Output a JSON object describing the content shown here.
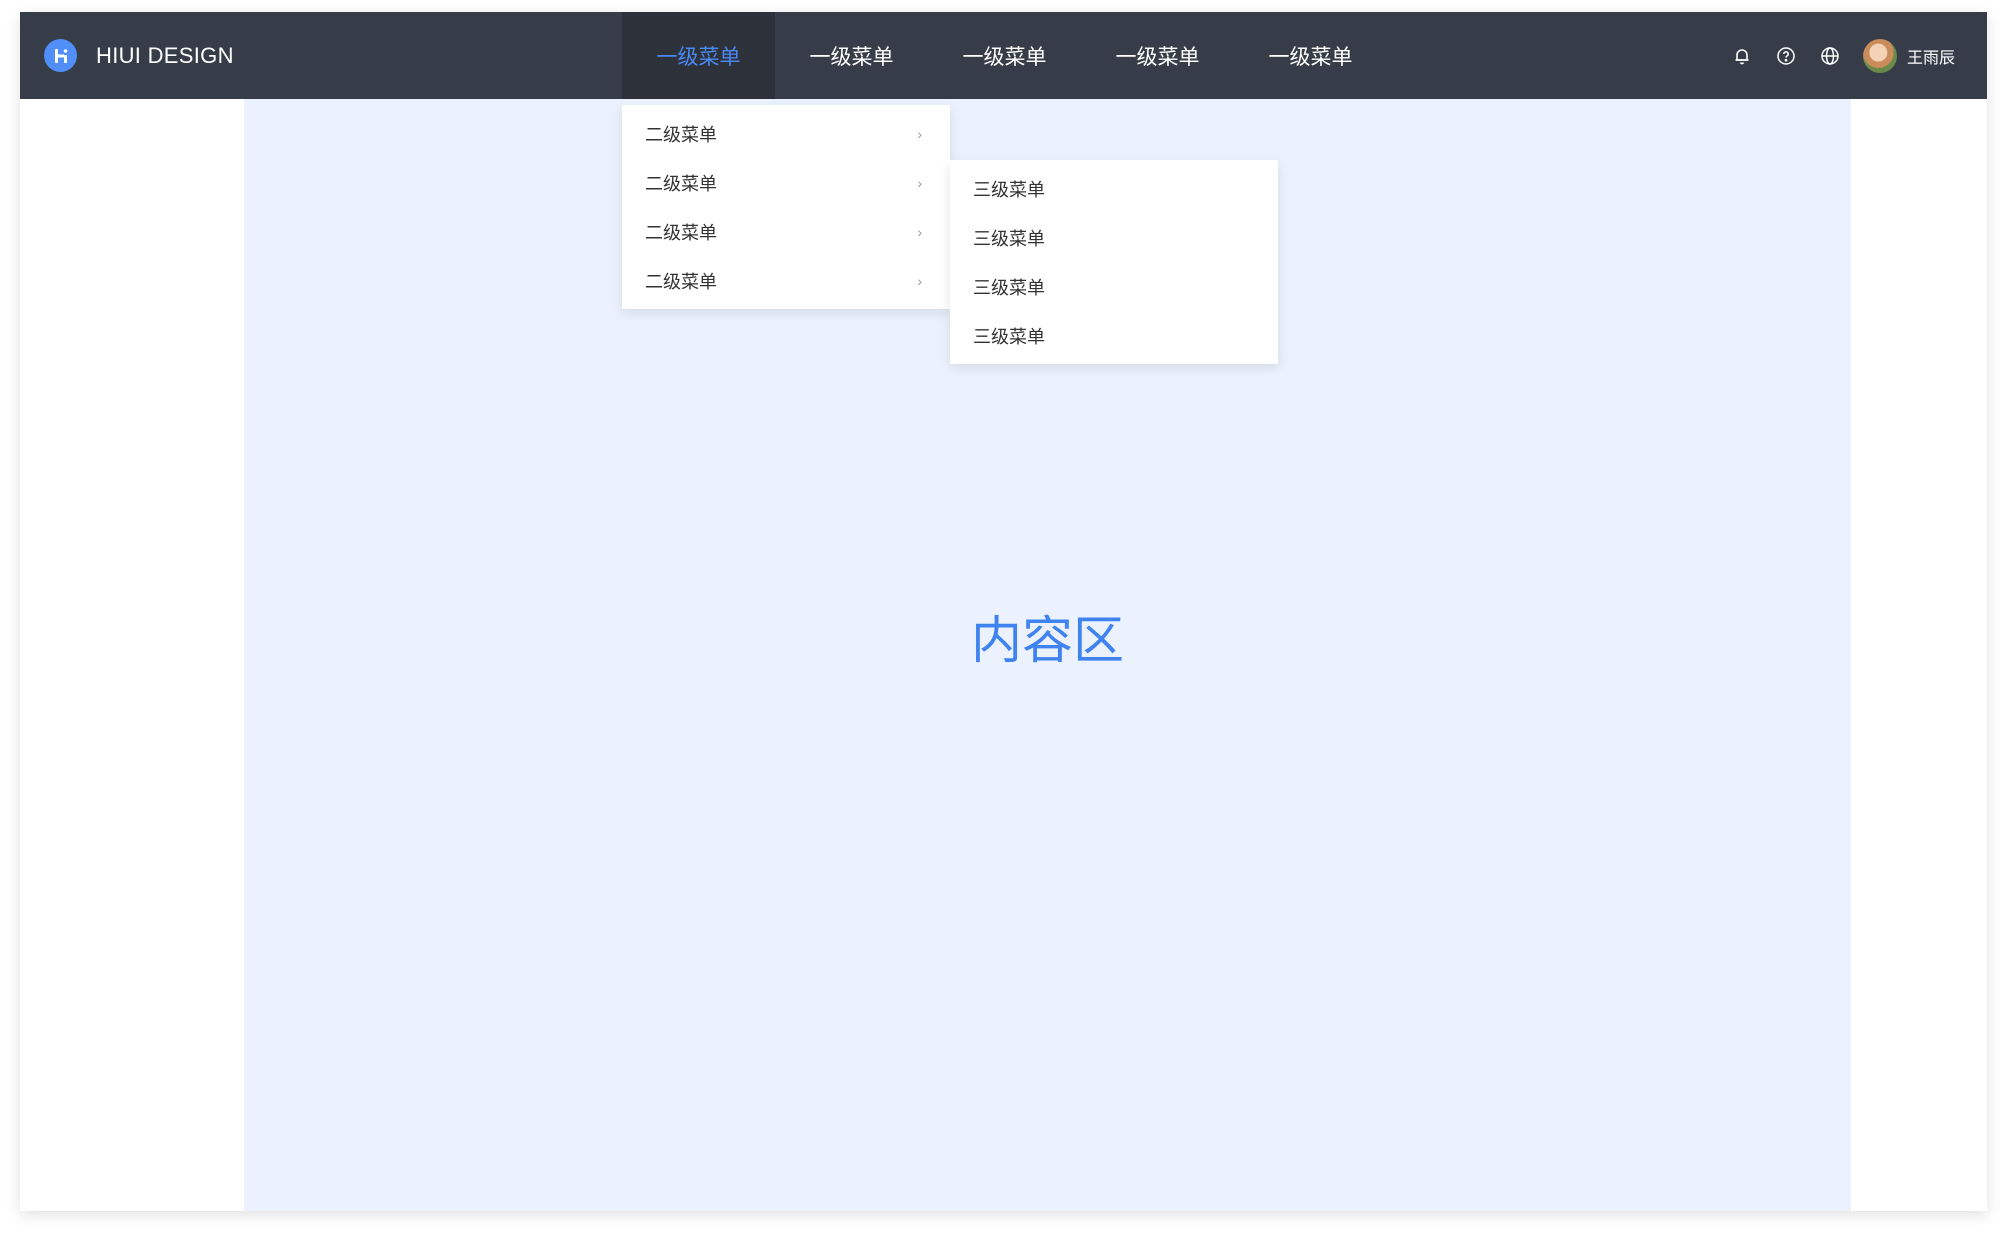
{
  "header": {
    "brand": "HIUI DESIGN",
    "nav": [
      {
        "label": "一级菜单",
        "active": true
      },
      {
        "label": "一级菜单",
        "active": false
      },
      {
        "label": "一级菜单",
        "active": false
      },
      {
        "label": "一级菜单",
        "active": false
      },
      {
        "label": "一级菜单",
        "active": false
      }
    ],
    "icons": [
      "bell-icon",
      "help-icon",
      "globe-icon"
    ],
    "user": {
      "name": "王雨辰"
    }
  },
  "submenu_level2": {
    "items": [
      {
        "label": "二级菜单"
      },
      {
        "label": "二级菜单"
      },
      {
        "label": "二级菜单"
      },
      {
        "label": "二级菜单"
      }
    ]
  },
  "submenu_level3": {
    "items": [
      {
        "label": "三级菜单"
      },
      {
        "label": "三级菜单"
      },
      {
        "label": "三级菜单"
      },
      {
        "label": "三级菜单"
      }
    ]
  },
  "main": {
    "label": "内容区"
  },
  "colors": {
    "topbar": "#373d48",
    "accent": "#4a88f2",
    "content_bg": "#ebf2fe"
  }
}
